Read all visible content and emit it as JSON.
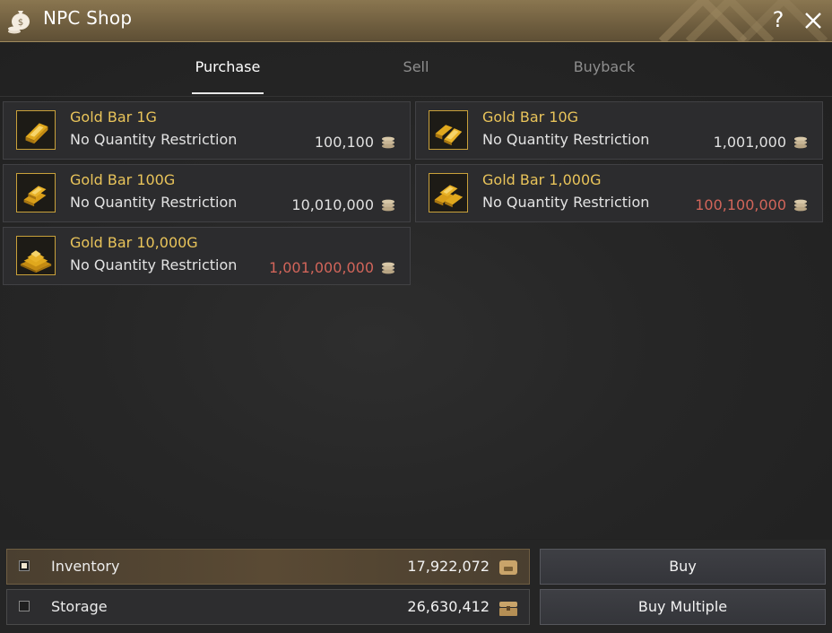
{
  "window": {
    "title": "NPC Shop",
    "help_label": "?",
    "icons": {
      "title": "money-bag-icon",
      "close": "close-icon"
    }
  },
  "tabs": [
    {
      "label": "Purchase",
      "active": true
    },
    {
      "label": "Sell",
      "active": false
    },
    {
      "label": "Buyback",
      "active": false
    }
  ],
  "items": [
    {
      "name": "Gold Bar 1G",
      "restriction": "No Quantity Restriction",
      "price": "100,100",
      "affordable": true
    },
    {
      "name": "Gold Bar 10G",
      "restriction": "No Quantity Restriction",
      "price": "1,001,000",
      "affordable": true
    },
    {
      "name": "Gold Bar 100G",
      "restriction": "No Quantity Restriction",
      "price": "10,010,000",
      "affordable": true
    },
    {
      "name": "Gold Bar 1,000G",
      "restriction": "No Quantity Restriction",
      "price": "100,100,000",
      "affordable": false
    },
    {
      "name": "Gold Bar 10,000G",
      "restriction": "No Quantity Restriction",
      "price": "1,001,000,000",
      "affordable": false
    }
  ],
  "wallet": {
    "inventory": {
      "label": "Inventory",
      "amount": "17,922,072",
      "selected": true
    },
    "storage": {
      "label": "Storage",
      "amount": "26,630,412",
      "selected": false
    }
  },
  "buttons": {
    "buy": "Buy",
    "buy_multiple": "Buy Multiple"
  },
  "colors": {
    "item_name": "#e9c45a",
    "price_unaffordable": "#d2655a",
    "title_bar": "#7a6747"
  }
}
